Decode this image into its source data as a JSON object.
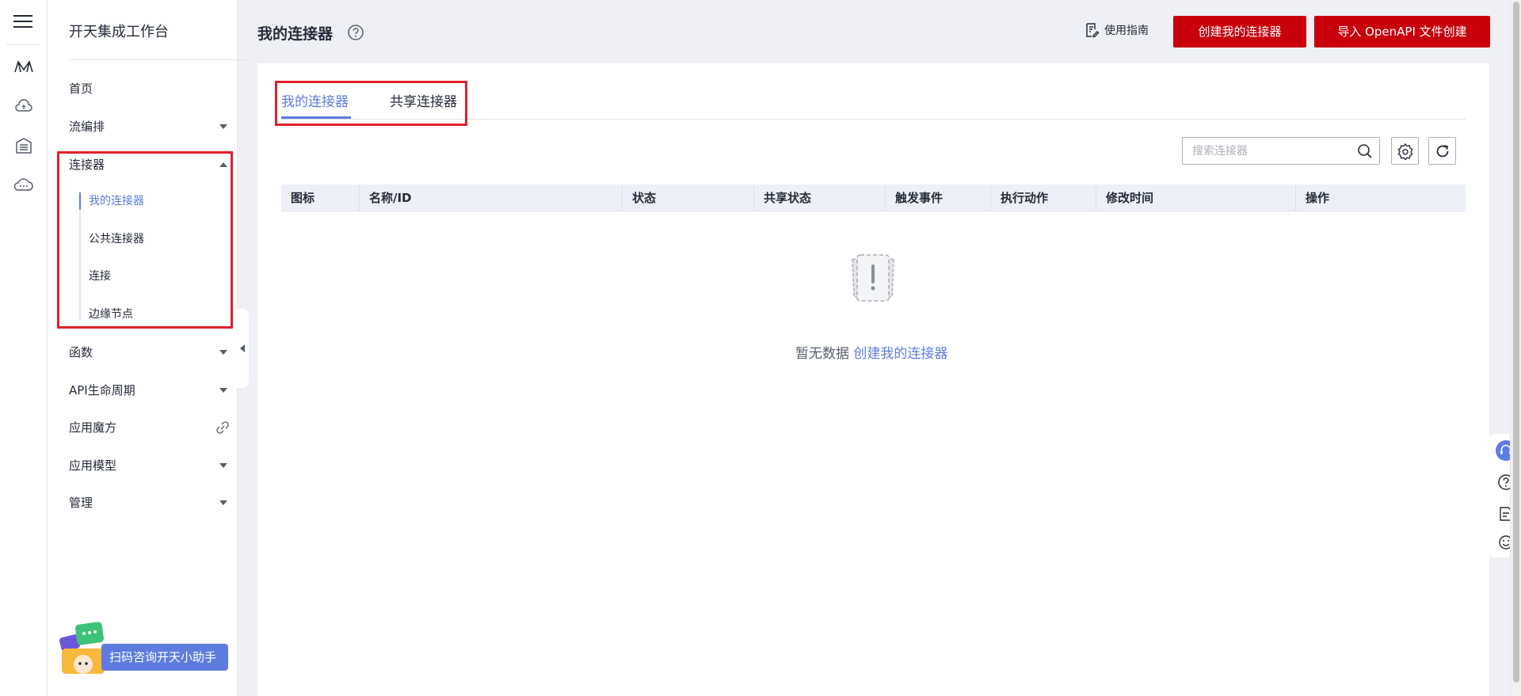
{
  "app": {
    "brand": "开天集成工作台",
    "page_title": "我的连接器"
  },
  "rail": {
    "icons": [
      "menu-icon",
      "logo-m-icon",
      "cloud-icon",
      "building-icon",
      "cloud-more-icon"
    ]
  },
  "sidenav": {
    "items": [
      {
        "label": "首页"
      },
      {
        "label": "流编排"
      },
      {
        "label": "连接器"
      },
      {
        "label": "函数"
      },
      {
        "label": "API生命周期"
      },
      {
        "label": "应用魔方"
      },
      {
        "label": "应用模型"
      },
      {
        "label": "管理"
      }
    ],
    "connector_sub": [
      {
        "label": "我的连接器",
        "active": true
      },
      {
        "label": "公共连接器"
      },
      {
        "label": "连接"
      },
      {
        "label": "边缘节点"
      }
    ]
  },
  "assistant": {
    "label": "扫码咨询开天小助手"
  },
  "header": {
    "guide_label": "使用指南",
    "create_label": "创建我的连接器",
    "import_label": "导入 OpenAPI 文件创建"
  },
  "tabs": [
    {
      "label": "我的连接器",
      "active": true
    },
    {
      "label": "共享连接器"
    }
  ],
  "search": {
    "placeholder": "搜索连接器",
    "value": ""
  },
  "table": {
    "columns": [
      "图标",
      "名称/ID",
      "状态",
      "共享状态",
      "触发事件",
      "执行动作",
      "修改时间",
      "操作"
    ],
    "rows": []
  },
  "empty": {
    "text": "暂无数据",
    "link": "创建我的连接器"
  },
  "colors": {
    "accent": "#5e7ce0",
    "primary_button": "#c7000b",
    "highlight_box": "#e0202c"
  }
}
